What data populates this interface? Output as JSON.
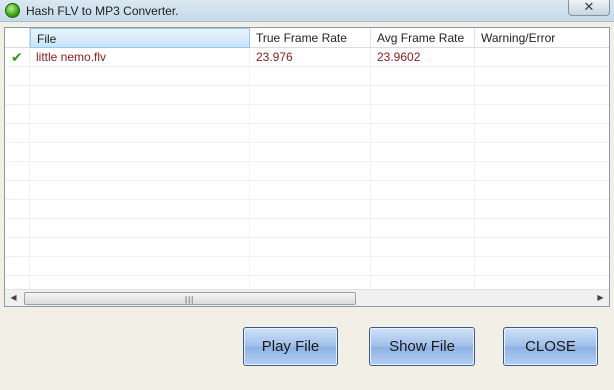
{
  "window": {
    "title": "Hash FLV to MP3 Converter.",
    "close_symbol": "✕"
  },
  "table": {
    "columns": [
      "",
      "File",
      "True Frame Rate",
      "Avg Frame Rate",
      "Warning/Error"
    ],
    "rows": [
      {
        "status_icon": "checkmark-icon",
        "status_glyph": "✔",
        "file": "little nemo.flv",
        "true_frame_rate": "23.976",
        "avg_frame_rate": "23.9602",
        "warning_error": ""
      }
    ]
  },
  "scrollbar": {
    "left_arrow": "◀",
    "right_arrow": "▶",
    "grip": "|||"
  },
  "buttons": {
    "play": "Play File",
    "show": "Show File",
    "close": "CLOSE"
  },
  "colors": {
    "row_text": "#8b1a1a",
    "check": "#2e9a17",
    "button_border": "#3b5a8a"
  }
}
